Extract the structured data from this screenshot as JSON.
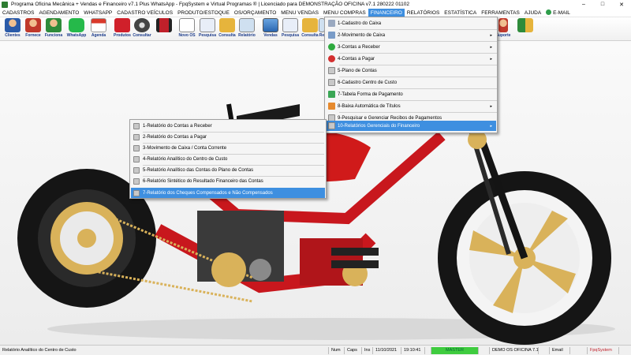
{
  "window": {
    "title": "Programa Oficina Mecânica + Vendas e Financeiro v7.1 Plus WhatsApp - FpqSystem e Virtual Programas ® | Licenciado para  DEMONSTRAÇÃO OFICINA v7.1 280222 01102",
    "minimize": "–",
    "maximize": "□",
    "close": "✕"
  },
  "menubar": {
    "items": [
      "CADASTROS",
      "AGENDAMENTO",
      "WHATSAPP",
      "CADASTRO VEÍCULOS",
      "PRODUTO/ESTOQUE",
      "OS/ORÇAMENTO",
      "MENU VENDAS",
      "MENU COMPRAS",
      "FINANCEIRO",
      "RELATÓRIOS",
      "ESTATÍSTICA",
      "FERRAMENTAS",
      "AJUDA",
      "E-MAIL"
    ]
  },
  "toolbar": {
    "items": [
      "Clientes",
      "Fornece",
      "Funciona",
      "WhatsApp",
      "Agenda",
      "Produtos",
      "Consultar",
      "",
      "Novo OS",
      "Pesquisa",
      "Consulta",
      "Relatório",
      "Vendas",
      "Pesquisa",
      "Consulta",
      "Re",
      "Suporte",
      ""
    ]
  },
  "financeiro_menu": {
    "items": [
      {
        "label": "1-Cadastro do Caixa",
        "submenu": false
      },
      {
        "label": "2-Movimento de Caixa",
        "submenu": true
      },
      {
        "label": "3-Contas a Receber",
        "submenu": true
      },
      {
        "label": "4-Contas a Pagar",
        "submenu": true
      },
      {
        "label": "5-Plano de Contas",
        "submenu": false
      },
      {
        "label": "6-Cadastro Centro de Custo",
        "submenu": false
      },
      {
        "label": "7-Tabela Forma de Pagamento",
        "submenu": false
      },
      {
        "label": "8-Baixa Automática de Títulos",
        "submenu": true
      },
      {
        "label": "9-Pesquisar e Gerenciar Recibos de Pagamentos",
        "submenu": false
      },
      {
        "label": "10-Relatórios Gerenciais do Financeiro",
        "submenu": true
      }
    ],
    "arrow": "▸"
  },
  "relatorios_submenu": {
    "items": [
      "1-Relatório do Contas a Receber",
      "2-Relatório do Contas a Pagar",
      "3-Movimento de Caixa / Conta Corrente",
      "4-Relatório Analítico do Centro de Custo",
      "5-Relatório Analítico das Contas do Plano de Contas",
      "6-Relatório Sintético do Resultado Financeiro das Contas",
      "7-Relatório dos Cheques Compensados e Não Compensados"
    ]
  },
  "statusbar": {
    "message": "Relatório Analítico do Centro de Custo",
    "num": "Num",
    "caps": "Caps",
    "ins": "Ins",
    "date": "11/10/2021",
    "time": "19:10:41",
    "master": "MASTER",
    "demo": "DEMO OS OFICINA 7.1",
    "email": "Email",
    "fpq": "FpqSystem"
  },
  "colors": {
    "menu_highlight": "#3e8fe0",
    "master_green": "#3fcc3f",
    "bike_red": "#d01a1a",
    "gold": "#d9b25a"
  }
}
